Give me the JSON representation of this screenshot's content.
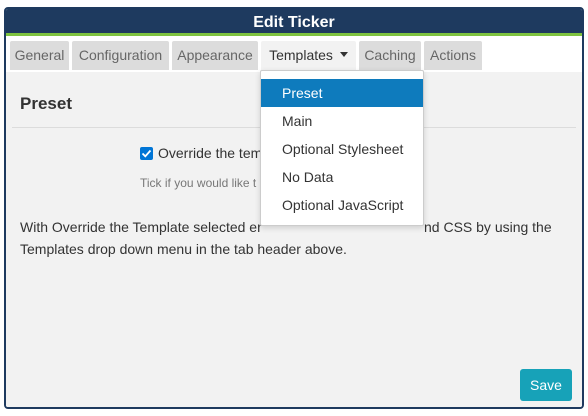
{
  "dialog": {
    "title": "Edit Ticker"
  },
  "tabs": [
    {
      "label": "General"
    },
    {
      "label": "Configuration"
    },
    {
      "label": "Appearance"
    },
    {
      "label": "Templates"
    },
    {
      "label": "Caching"
    },
    {
      "label": "Actions"
    }
  ],
  "dropdown": {
    "items": [
      {
        "label": "Preset",
        "selected": true
      },
      {
        "label": "Main"
      },
      {
        "label": "Optional Stylesheet"
      },
      {
        "label": "No Data"
      },
      {
        "label": "Optional JavaScript"
      }
    ]
  },
  "content": {
    "section_title": "Preset",
    "checkbox_label": "Override the tem",
    "checkbox_checked": true,
    "help_text": "Tick if you would like t",
    "description_left": "With Override the Template selected er",
    "description_right": "nd CSS by using the",
    "description_line2": "Templates drop down menu in the tab header above."
  },
  "footer": {
    "save_label": "Save"
  },
  "colors": {
    "titlebar": "#1e3a5f",
    "accent_line": "#7ec33f",
    "selected_item": "#0e7bbd",
    "save_button": "#17a2b8",
    "checkbox": "#0075d6"
  }
}
